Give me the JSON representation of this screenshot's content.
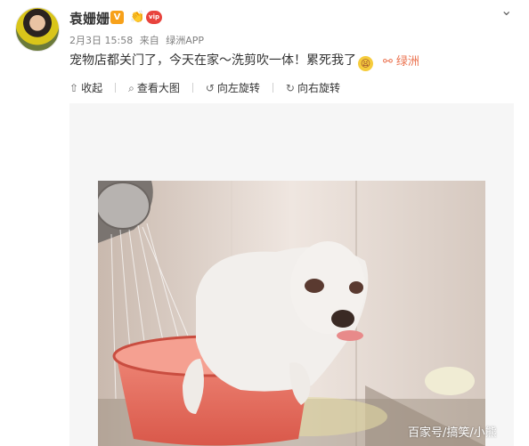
{
  "post": {
    "author": "袁姗姗",
    "date": "2月3日 15:58",
    "source_prefix": "来自",
    "source": "绿洲APP",
    "text": "宠物店都关门了，今天在家～洗剪吹一体！累死我了",
    "topic_link": "绿洲"
  },
  "toolbar": {
    "collapse": "收起",
    "view_large": "查看大图",
    "rotate_left": "向左旋转",
    "rotate_right": "向右旋转"
  },
  "icons": {
    "verified": "V",
    "vip": "vip"
  },
  "watermark": "百家号/搞笑/小熊",
  "colors": {
    "link": "#eb7350",
    "verified": "#f7a11a",
    "vip": "#e8433d"
  }
}
